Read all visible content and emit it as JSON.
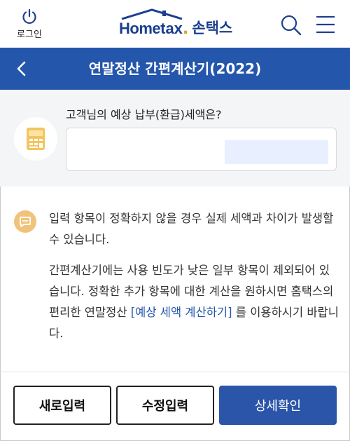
{
  "header": {
    "login_label": "로그인",
    "logo_home": "Home",
    "logo_tax": "tax",
    "logo_dot": ".",
    "logo_korean": "손택스"
  },
  "titlebar": {
    "title": "연말정산 간편계산기(2022)"
  },
  "question": {
    "label": "고객님의 예상 납부(환급)세액은?",
    "value": ""
  },
  "notice": {
    "paragraph1": "입력 항목이 정확하지 않을 경우 실제 세액과 차이가 발생할 수 있습니다.",
    "paragraph2_before": "간편계산기에는 사용 빈도가 낮은 일부 항목이 제외되어 있습니다. 정확한 추가 항목에 대한 계산을 원하시면 홈택스의 편리한 연말정산 ",
    "paragraph2_link": "[예상 세액 계산하기]",
    "paragraph2_after": " 를 이용하시기 바랍니다."
  },
  "buttons": {
    "new_input": "새로입력",
    "edit_input": "수정입력",
    "detail": "상세확인"
  },
  "colors": {
    "primary": "#2456ac",
    "logo_accent": "#e0a020",
    "notice_icon": "#f0c37a",
    "panel_bg": "#f4f5f7"
  },
  "icons": {
    "login": "power-icon",
    "search": "search-icon",
    "menu": "hamburger-menu-icon",
    "back": "chevron-left-icon",
    "calculator": "calculator-icon",
    "notice": "speech-bubble-icon"
  }
}
